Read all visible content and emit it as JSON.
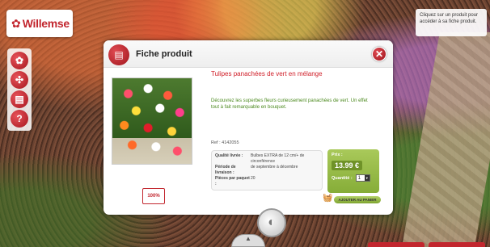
{
  "logo": {
    "text": "Willemse",
    "flower_icon": "flower-icon"
  },
  "sidebar": {
    "buttons": [
      {
        "icon": "flower-icon",
        "glyph": "✿"
      },
      {
        "icon": "compass-icon",
        "glyph": "✣"
      },
      {
        "icon": "list-icon",
        "glyph": "▤"
      },
      {
        "icon": "help-icon",
        "glyph": "?"
      }
    ]
  },
  "hint": {
    "text": "Cliquez sur un produit pour accéder à sa fiche produit."
  },
  "modal": {
    "title": "Fiche produit",
    "close_glyph": "✕",
    "product": {
      "name": "Tulipes panachées de vert en mélange",
      "description": "Découvrez les superbes fleurs curieusement panachées de vert. Un effet tout à fait remarquable en bouquet.",
      "ref": "Ref : 4142055",
      "info": [
        {
          "label": "Qualité livrée :",
          "value": "Bulbes EXTRA de 12 cm/+ de circonférence"
        },
        {
          "label": "Période de livraison :",
          "value": "de septembre à décembre"
        },
        {
          "label": "Pièces par paquet :",
          "value": "20"
        }
      ],
      "price_label": "Prix :",
      "price": "13.99 €",
      "quantity_label": "Quantité :",
      "quantity": "1",
      "badge": "100%",
      "add_to_cart": "AJOUTER AU PANIER"
    }
  },
  "colors": {
    "brand_red": "#c2262e",
    "price_green": "#86ad38",
    "desc_green": "#4c8a1f"
  }
}
